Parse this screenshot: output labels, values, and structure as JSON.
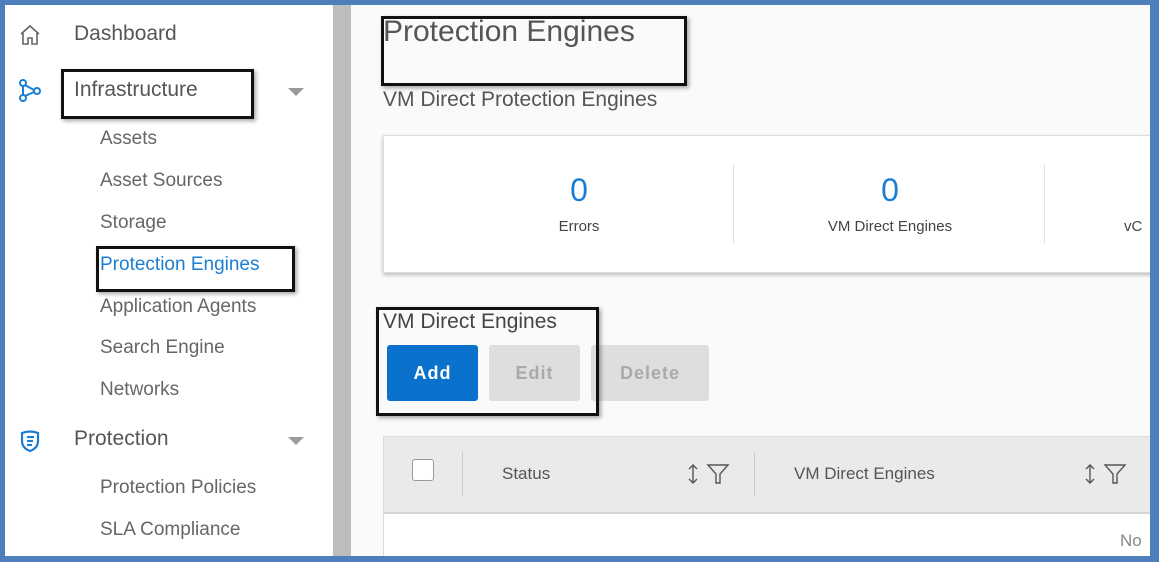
{
  "sidebar": {
    "items": [
      {
        "label": "Dashboard",
        "icon": "home-icon"
      },
      {
        "label": "Infrastructure",
        "icon": "infrastructure-nodes-icon",
        "expanded": true,
        "children": [
          "Assets",
          "Asset Sources",
          "Storage",
          "Protection Engines",
          "Application Agents",
          "Search Engine",
          "Networks"
        ],
        "active_child": "Protection Engines"
      },
      {
        "label": "Protection",
        "icon": "shield-icon",
        "expanded": true,
        "children": [
          "Protection Policies",
          "SLA Compliance"
        ]
      }
    ]
  },
  "main": {
    "title": "Protection Engines",
    "subtitle": "VM Direct Protection Engines",
    "stats": [
      {
        "value": "0",
        "label": "Errors"
      },
      {
        "value": "0",
        "label": "VM Direct Engines"
      },
      {
        "value": "",
        "label": "vC"
      }
    ],
    "section_title": "VM Direct Engines",
    "buttons": {
      "add": "Add",
      "edit": "Edit",
      "delete": "Delete"
    },
    "table": {
      "columns": [
        "Status",
        "VM Direct Engines"
      ],
      "empty_text": "No"
    }
  },
  "colors": {
    "accent": "#0a72cc",
    "link_active": "#1a7fd4",
    "frame_border": "#4e7fbc"
  }
}
